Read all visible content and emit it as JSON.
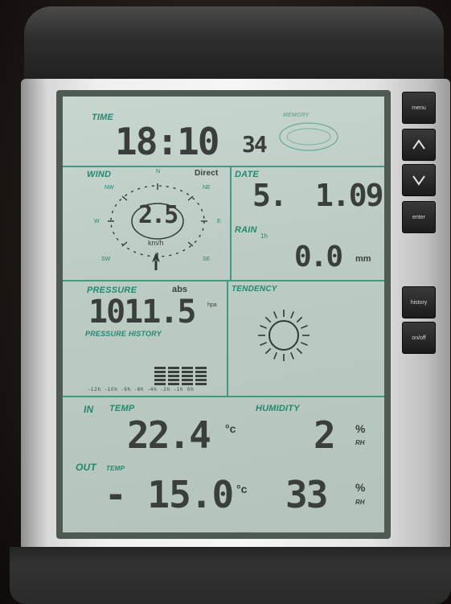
{
  "buttons": {
    "menu": "menu",
    "up": "up-arrow",
    "down": "down-arrow",
    "enter": "enter",
    "history": "history",
    "on_off": "on/off"
  },
  "time": {
    "label": "TIME",
    "hours_minutes": "18:10",
    "seconds": "34",
    "memory_label": "MEMORY"
  },
  "wind": {
    "label": "WIND",
    "direct": "Direct",
    "speed": "2.5",
    "unit": "km/h",
    "directions": {
      "n": "N",
      "ne": "NE",
      "e": "E",
      "se": "SE",
      "sw": "SW",
      "w": "W",
      "nw": "NW"
    }
  },
  "date": {
    "label": "DATE",
    "day": "5.",
    "month_year": "1.09"
  },
  "rain": {
    "label": "RAIN",
    "period": "1h",
    "value": "0.0",
    "unit": "mm"
  },
  "pressure": {
    "label": "PRESSURE",
    "mode": "abs",
    "value": "1011.5",
    "unit": "hpa",
    "history_label": "PRESSURE HISTORY",
    "history_ticks": "-12h -10h -9h -6h -4h -2h -1h 0h",
    "history_bars": [
      0,
      0,
      0,
      0,
      5,
      5,
      5,
      5
    ]
  },
  "tendency": {
    "label": "TENDENCY",
    "icon": "sun-icon"
  },
  "indoor": {
    "label": "IN",
    "temp_label": "TEMP",
    "temp": "22.4",
    "temp_unit": "°c",
    "humidity_label": "HUMIDITY",
    "humidity": "2",
    "humidity_unit": "%",
    "rh": "RH"
  },
  "outdoor": {
    "label": "OUT",
    "temp_label": "TEMP",
    "temp": "- 15.0",
    "temp_unit": "°c",
    "humidity": "33",
    "humidity_unit": "%",
    "rh": "RH"
  },
  "colors": {
    "lcd_bg": "#bccbc4",
    "lcd_line": "#3f9a82",
    "segment": "#3a3f3c",
    "label": "#1f8a6e"
  }
}
